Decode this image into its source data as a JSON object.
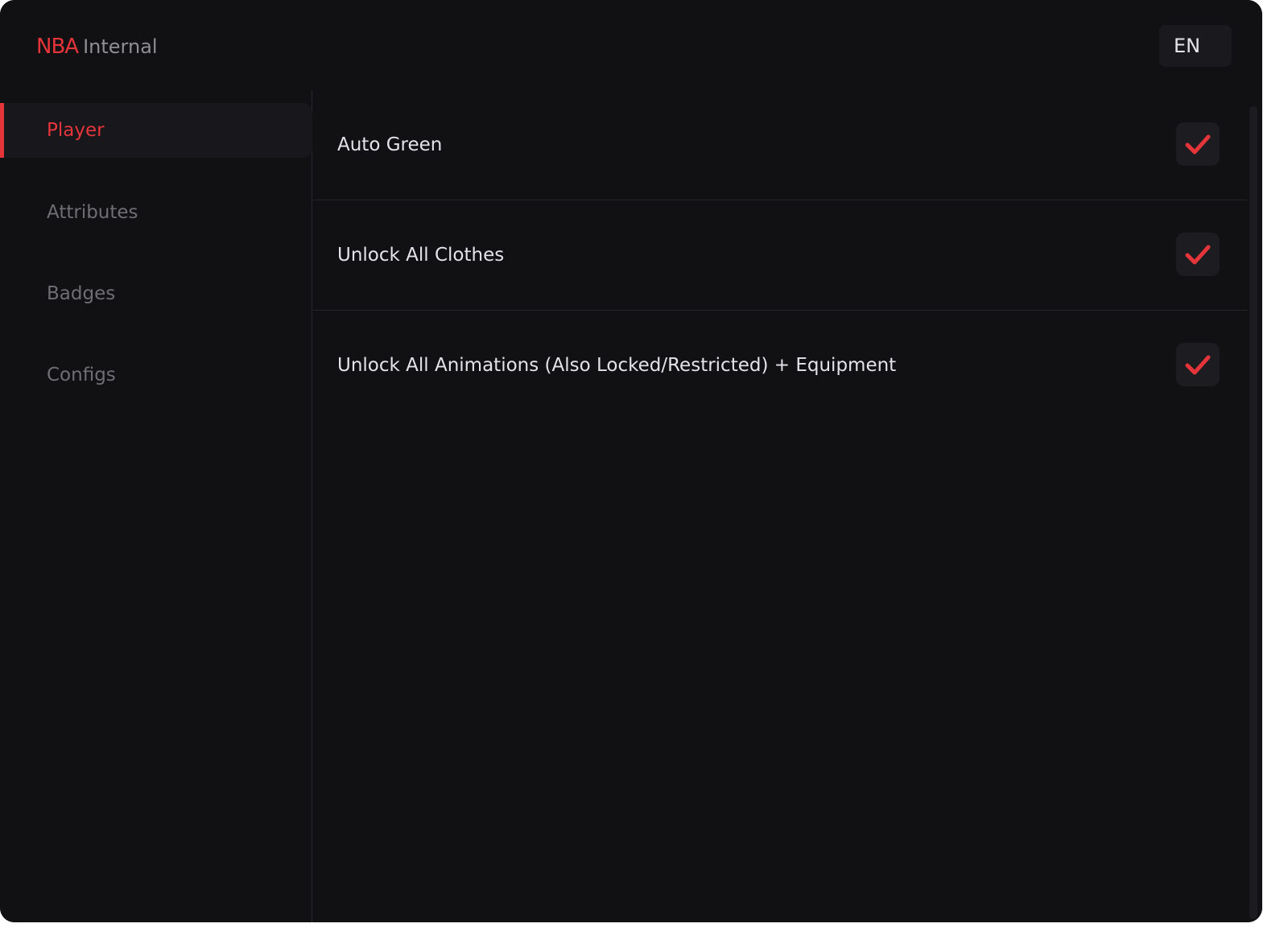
{
  "header": {
    "brand_strong": "NBA",
    "brand_light": "Internal",
    "language": "EN"
  },
  "sidebar": {
    "items": [
      {
        "label": "Player",
        "active": true
      },
      {
        "label": "Attributes",
        "active": false
      },
      {
        "label": "Badges",
        "active": false
      },
      {
        "label": "Configs",
        "active": false
      }
    ]
  },
  "options": [
    {
      "label": "Auto Green",
      "checked": true
    },
    {
      "label": "Unlock All Clothes",
      "checked": true
    },
    {
      "label": "Unlock All Animations (Also Locked/Restricted) + Equipment",
      "checked": true
    }
  ],
  "colors": {
    "accent": "#e5353b",
    "background": "#111114",
    "checkbox_bg": "#1d1d21"
  },
  "icons": {
    "checkmark": "check-icon"
  }
}
